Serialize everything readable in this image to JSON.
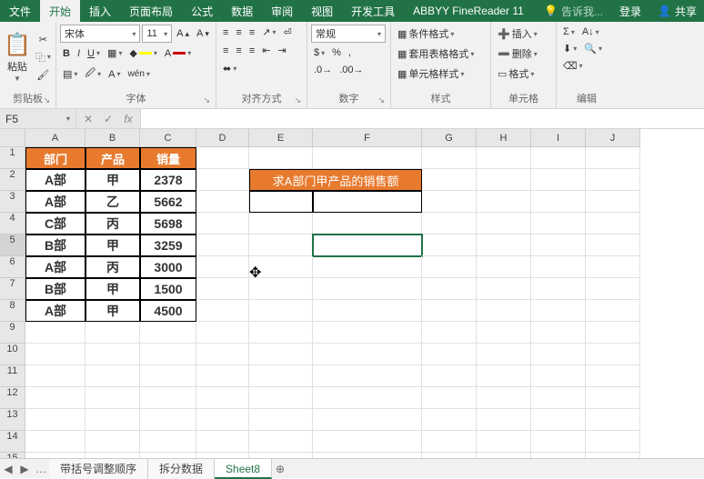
{
  "tabs": {
    "file": "文件",
    "home": "开始",
    "insert": "插入",
    "layout": "页面布局",
    "formulas": "公式",
    "data": "数据",
    "review": "审阅",
    "view": "视图",
    "dev": "开发工具",
    "addin": "ABBYY FineReader 11",
    "tellme": "告诉我...",
    "login": "登录",
    "share": "共享"
  },
  "ribbon": {
    "clipboard": {
      "paste": "粘贴",
      "label": "剪贴板"
    },
    "font": {
      "name": "宋体",
      "size": "11",
      "label": "字体"
    },
    "align": {
      "normal": "常规",
      "label": "对齐方式"
    },
    "number": {
      "label": "数字"
    },
    "styles": {
      "condfmt": "条件格式",
      "tablefmt": "套用表格格式",
      "cellstyle": "单元格样式",
      "label": "样式"
    },
    "cells": {
      "insert": "插入",
      "delete": "删除",
      "format": "格式",
      "label": "单元格"
    },
    "editing": {
      "sum": "Σ",
      "label": "编辑"
    }
  },
  "namebox": "F5",
  "cols": [
    "A",
    "B",
    "C",
    "D",
    "E",
    "F",
    "G",
    "H",
    "I",
    "J"
  ],
  "table": {
    "headers": [
      "部门",
      "产品",
      "销量"
    ],
    "rows": [
      [
        "A部",
        "甲",
        "2378"
      ],
      [
        "A部",
        "乙",
        "5662"
      ],
      [
        "C部",
        "丙",
        "5698"
      ],
      [
        "B部",
        "甲",
        "3259"
      ],
      [
        "A部",
        "丙",
        "3000"
      ],
      [
        "B部",
        "甲",
        "1500"
      ],
      [
        "A部",
        "甲",
        "4500"
      ]
    ]
  },
  "banner": "求A部门甲产品的销售额",
  "sheets": {
    "s1": "带括号调整顺序",
    "s2": "拆分数据",
    "s3": "Sheet8"
  }
}
